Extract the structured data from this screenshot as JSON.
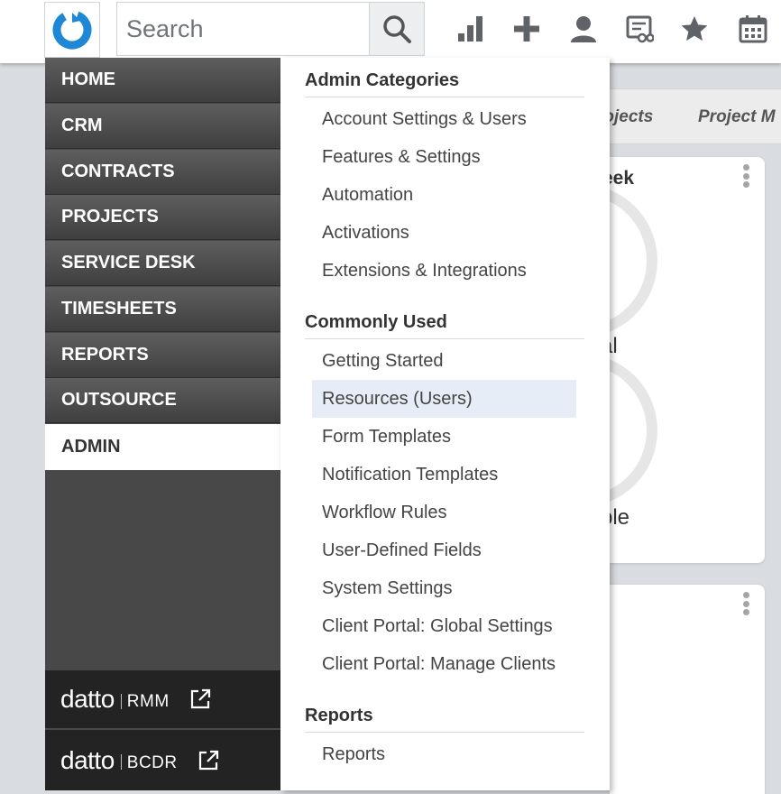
{
  "search": {
    "placeholder": "Search"
  },
  "toolbar": {
    "icons": [
      "bar-chart-icon",
      "plus-icon",
      "user-icon",
      "timesheet-icon",
      "star-icon",
      "calendar-icon"
    ]
  },
  "background": {
    "tabs": [
      "rojects",
      "Project M"
    ],
    "card1": {
      "title": "eek",
      "label1": "al",
      "label2": "ble"
    }
  },
  "nav": {
    "items": [
      "HOME",
      "CRM",
      "CONTRACTS",
      "PROJECTS",
      "SERVICE DESK",
      "TIMESHEETS",
      "REPORTS",
      "OUTSOURCE",
      "ADMIN"
    ],
    "active": "ADMIN",
    "external": [
      {
        "brand": "datto",
        "product": "RMM"
      },
      {
        "brand": "datto",
        "product": "BCDR"
      }
    ]
  },
  "admin": {
    "sections": [
      {
        "title": "Admin Categories",
        "items": [
          "Account Settings & Users",
          "Features & Settings",
          "Automation",
          "Activations",
          "Extensions & Integrations"
        ]
      },
      {
        "title": "Commonly Used",
        "items": [
          "Getting Started",
          "Resources (Users)",
          "Form Templates",
          "Notification Templates",
          "Workflow Rules",
          "User-Defined Fields",
          "System Settings",
          "Client Portal: Global Settings",
          "Client Portal: Manage Clients"
        ]
      },
      {
        "title": "Reports",
        "items": [
          "Reports"
        ]
      }
    ],
    "highlighted": "Resources (Users)"
  },
  "colors": {
    "accent": "#1e88d6",
    "nav_bg": "#484848",
    "highlight": "#e7edf6"
  }
}
